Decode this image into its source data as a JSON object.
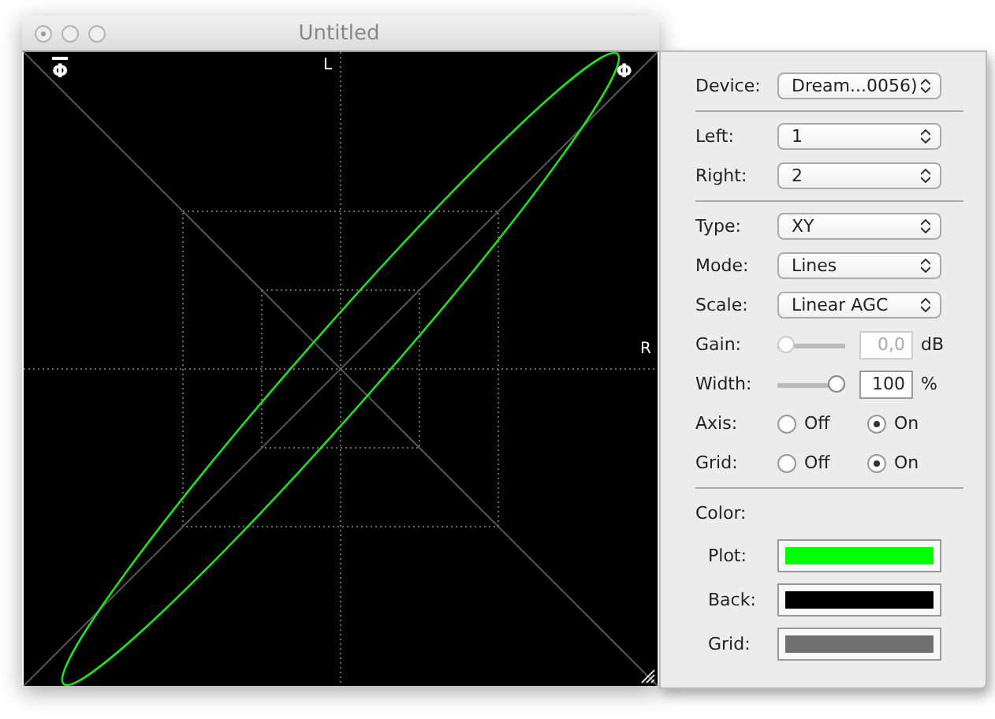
{
  "window": {
    "title": "Untitled"
  },
  "scope": {
    "axis_labels": [
      {
        "text": "L",
        "kind": "top"
      },
      {
        "text": "R",
        "kind": "right"
      }
    ],
    "phase_marks": [
      {
        "text": "Φ",
        "overline": true
      },
      {
        "text": "Φ",
        "overline": false
      }
    ]
  },
  "panel": {
    "device": {
      "label": "Device:",
      "value": "Dream...0056)"
    },
    "channels": [
      {
        "label": "Left:",
        "value": "1"
      },
      {
        "label": "Right:",
        "value": "2"
      }
    ],
    "display": [
      {
        "label": "Type:",
        "value": "XY"
      },
      {
        "label": "Mode:",
        "value": "Lines"
      },
      {
        "label": "Scale:",
        "value": "Linear AGC"
      }
    ],
    "sliders": [
      {
        "label": "Gain:",
        "level": 0,
        "value": "0,0",
        "unit": "dB",
        "disabled": true
      },
      {
        "label": "Width:",
        "level": 1,
        "value": "100",
        "unit": "%",
        "disabled": false
      }
    ],
    "toggles": [
      {
        "label": "Axis:",
        "options": [
          {
            "label": "Off",
            "selected": false
          },
          {
            "label": "On",
            "selected": true
          }
        ]
      },
      {
        "label": "Grid:",
        "options": [
          {
            "label": "Off",
            "selected": false
          },
          {
            "label": "On",
            "selected": true
          }
        ]
      }
    ],
    "color": {
      "label": "Color:",
      "swatches": [
        {
          "label": "Plot:",
          "color": "#00ff00"
        },
        {
          "label": "Back:",
          "color": "#000000"
        },
        {
          "label": "Grid:",
          "color": "#707070"
        }
      ]
    }
  }
}
